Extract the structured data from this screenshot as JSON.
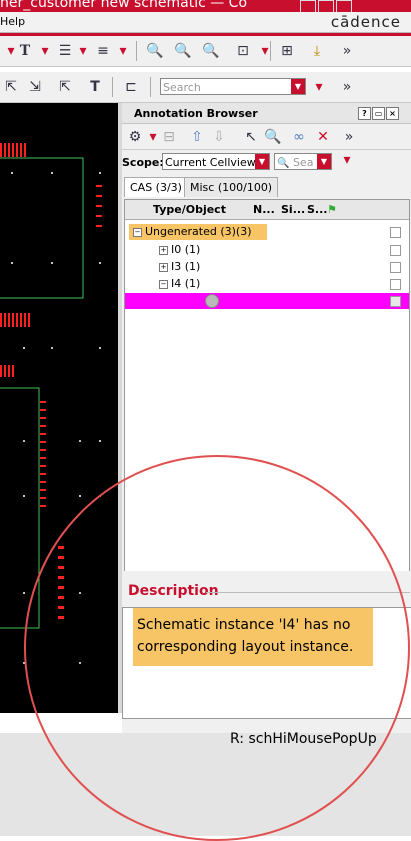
{
  "window": {
    "title": "ner_customer new schematic — Co"
  },
  "menubar": {
    "help": "Help",
    "logo": "cādence"
  },
  "toolbar2": {
    "search_placeholder": "Search"
  },
  "panel": {
    "title": "Annotation Browser",
    "scope_label": "Scope:",
    "scope_value": "Current Cellview",
    "search_placeholder": "Sea",
    "tabs": [
      "CAS (3/3)",
      "Misc (100/100)"
    ],
    "columns": [
      "Type/Object",
      "N...",
      "Si...",
      "S..."
    ],
    "rows": [
      {
        "label": "Ungenerated (3)(3)"
      },
      {
        "label": "I0 (1)"
      },
      {
        "label": "I3 (1)"
      },
      {
        "label": "I4 (1)"
      }
    ]
  },
  "description": {
    "title": "Description",
    "text": "Schematic instance 'I4' has no corresponding layout instance."
  },
  "status": {
    "text": "R: schHiMousePopUp"
  },
  "colors": {
    "accent": "#c8102e",
    "highlight": "#f7c565",
    "selected_row": "#ff00ff",
    "schematic_wire": "#3fc45a",
    "pin": "#ff2020"
  }
}
